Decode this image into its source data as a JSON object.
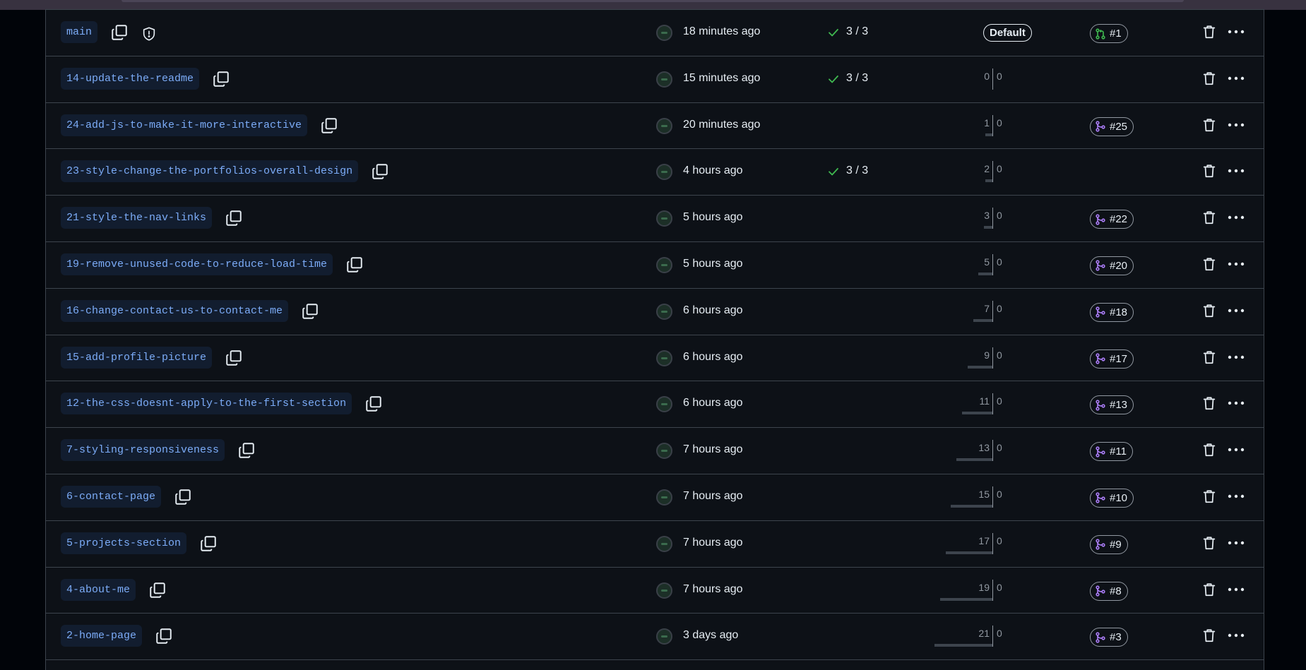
{
  "rows": [
    {
      "branch": "main",
      "updated": "18 minutes ago",
      "checks": "3 / 3",
      "default": "Default",
      "pr": "#1",
      "pr_state": "open",
      "protected": true
    },
    {
      "branch": "14-update-the-readme",
      "updated": "15 minutes ago",
      "checks": "3 / 3",
      "behind": "0",
      "ahead": "0"
    },
    {
      "branch": "24-add-js-to-make-it-more-interactive",
      "updated": "20 minutes ago",
      "behind": "1",
      "ahead": "0",
      "pr": "#25",
      "pr_state": "merged"
    },
    {
      "branch": "23-style-change-the-portfolios-overall-design",
      "updated": "4 hours ago",
      "checks": "3 / 3",
      "behind": "2",
      "ahead": "0"
    },
    {
      "branch": "21-style-the-nav-links",
      "updated": "5 hours ago",
      "behind": "3",
      "ahead": "0",
      "pr": "#22",
      "pr_state": "merged"
    },
    {
      "branch": "19-remove-unused-code-to-reduce-load-time",
      "updated": "5 hours ago",
      "behind": "5",
      "ahead": "0",
      "pr": "#20",
      "pr_state": "merged"
    },
    {
      "branch": "16-change-contact-us-to-contact-me",
      "updated": "6 hours ago",
      "behind": "7",
      "ahead": "0",
      "pr": "#18",
      "pr_state": "merged"
    },
    {
      "branch": "15-add-profile-picture",
      "updated": "6 hours ago",
      "behind": "9",
      "ahead": "0",
      "pr": "#17",
      "pr_state": "merged"
    },
    {
      "branch": "12-the-css-doesnt-apply-to-the-first-section",
      "updated": "6 hours ago",
      "behind": "11",
      "ahead": "0",
      "pr": "#13",
      "pr_state": "merged"
    },
    {
      "branch": "7-styling-responsiveness",
      "updated": "7 hours ago",
      "behind": "13",
      "ahead": "0",
      "pr": "#11",
      "pr_state": "merged"
    },
    {
      "branch": "6-contact-page",
      "updated": "7 hours ago",
      "behind": "15",
      "ahead": "0",
      "pr": "#10",
      "pr_state": "merged"
    },
    {
      "branch": "5-projects-section",
      "updated": "7 hours ago",
      "behind": "17",
      "ahead": "0",
      "pr": "#9",
      "pr_state": "merged"
    },
    {
      "branch": "4-about-me",
      "updated": "7 hours ago",
      "behind": "19",
      "ahead": "0",
      "pr": "#8",
      "pr_state": "merged"
    },
    {
      "branch": "2-home-page",
      "updated": "3 days ago",
      "behind": "21",
      "ahead": "0",
      "pr": "#3",
      "pr_state": "merged"
    }
  ],
  "colors": {
    "open": "#3fb950",
    "merged": "#ab7df8",
    "check": "#3fb950",
    "link": "#7cacf8"
  },
  "icons": {
    "copy": "copy-icon",
    "shield": "shield-icon",
    "check": "check-icon",
    "trash": "trash-icon",
    "kebab": "kebab-horizontal-icon",
    "pr_open": "git-pull-request-icon",
    "pr_merged": "git-merge-icon"
  }
}
